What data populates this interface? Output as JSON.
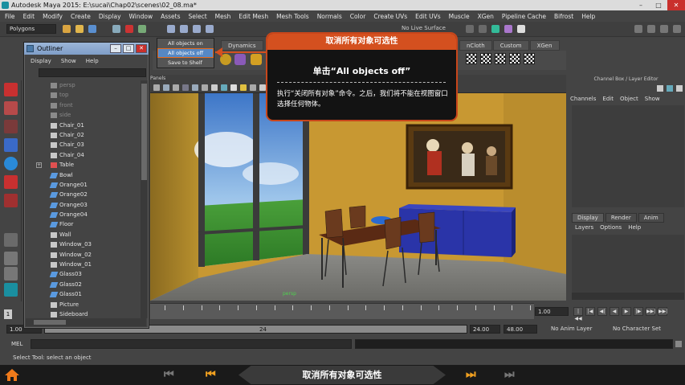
{
  "window": {
    "title": "Autodesk Maya 2015: E:\\sucai\\Chap02\\scenes\\02_08.ma*",
    "controls": [
      "–",
      "□",
      "✕"
    ]
  },
  "menubar": [
    "File",
    "Edit",
    "Modify",
    "Create",
    "Display",
    "Window",
    "Assets",
    "Select",
    "Mesh",
    "Edit Mesh",
    "Mesh Tools",
    "Normals",
    "Color",
    "Create UVs",
    "Edit UVs",
    "Muscle",
    "XGen",
    "Pipeline Cache",
    "Bifrost",
    "Help"
  ],
  "status_line": {
    "mode": "Polygons",
    "live_surface": "No Live Surface"
  },
  "shelf": {
    "tabs": [
      "Dynamics",
      "nCloth",
      "Custom",
      "XGen"
    ],
    "popup_items": [
      "All objects on",
      "All objects off",
      "Save to Shelf"
    ],
    "popup_selected_index": 1
  },
  "outliner": {
    "title": "Outliner",
    "menu": [
      "Display",
      "Show",
      "Help"
    ],
    "items": [
      {
        "label": "persp",
        "dim": true,
        "icon": "camera-icon"
      },
      {
        "label": "top",
        "dim": true,
        "icon": "camera-icon"
      },
      {
        "label": "front",
        "dim": true,
        "icon": "camera-icon"
      },
      {
        "label": "side",
        "dim": true,
        "icon": "camera-icon"
      },
      {
        "label": "Chair_01",
        "icon": "transform-icon"
      },
      {
        "label": "Chair_02",
        "icon": "transform-icon"
      },
      {
        "label": "Chair_03",
        "icon": "transform-icon"
      },
      {
        "label": "Chair_04",
        "icon": "transform-icon"
      },
      {
        "label": "Table",
        "icon": "group-icon",
        "expandable": true
      },
      {
        "label": "Bowl",
        "icon": "mesh-icon"
      },
      {
        "label": "Orange01",
        "icon": "mesh-icon"
      },
      {
        "label": "Orange02",
        "icon": "mesh-icon"
      },
      {
        "label": "Orange03",
        "icon": "mesh-icon"
      },
      {
        "label": "Orange04",
        "icon": "mesh-icon"
      },
      {
        "label": "Floor",
        "icon": "mesh-icon"
      },
      {
        "label": "Wall",
        "icon": "transform-icon"
      },
      {
        "label": "Window_03",
        "icon": "transform-icon"
      },
      {
        "label": "Window_02",
        "icon": "transform-icon"
      },
      {
        "label": "Window_01",
        "icon": "transform-icon"
      },
      {
        "label": "Glass03",
        "icon": "mesh-icon"
      },
      {
        "label": "Glass02",
        "icon": "mesh-icon"
      },
      {
        "label": "Glass01",
        "icon": "mesh-icon"
      },
      {
        "label": "Picture",
        "icon": "transform-icon"
      },
      {
        "label": "Sideboard",
        "icon": "transform-icon"
      }
    ]
  },
  "callout": {
    "header": "取消所有对象可选性",
    "step": "单击“All objects off”",
    "description": "执行“关闭所有对象”命令。之后，我们将不能在视图窗口选择任何物体。"
  },
  "viewport": {
    "panel_label": "Panels",
    "camera": "persp"
  },
  "channel_box": {
    "title": "Channel Box / Layer Editor",
    "menu": [
      "Channels",
      "Edit",
      "Object",
      "Show"
    ],
    "layer_tabs": [
      "Display",
      "Render",
      "Anim"
    ],
    "layer_menu": [
      "Layers",
      "Options",
      "Help"
    ]
  },
  "time_slider": {
    "ticks": [
      "1",
      "",
      "",
      "",
      "",
      "",
      "",
      "",
      "",
      "",
      "",
      "",
      "",
      "",
      "",
      "",
      "",
      "",
      "",
      "",
      ""
    ],
    "current_frame": "1",
    "current_value": "1.00",
    "playback_buttons": [
      "|◀◀",
      "|◀",
      "◀|",
      "◀",
      "▶",
      "|▶",
      "▶▶|",
      "▶▶|"
    ]
  },
  "range_slider": {
    "start": "1.00",
    "start2": "1.00",
    "mid_label": "24",
    "end": "24.00",
    "end2": "48.00",
    "anim_layer": "No Anim Layer",
    "character_set": "No Character Set"
  },
  "command_line": {
    "label": "MEL"
  },
  "help_line": "Select Tool: select an object",
  "bottom_bar": {
    "title": "取消所有对象可选性",
    "prev_all": "⏮",
    "prev": "⏮",
    "next": "⏭",
    "next_all": "⏭"
  },
  "colors": {
    "accent": "#d4501f",
    "selection": "#5688c4",
    "wall": "#c8962f",
    "sideboard": "#2a34a8"
  }
}
